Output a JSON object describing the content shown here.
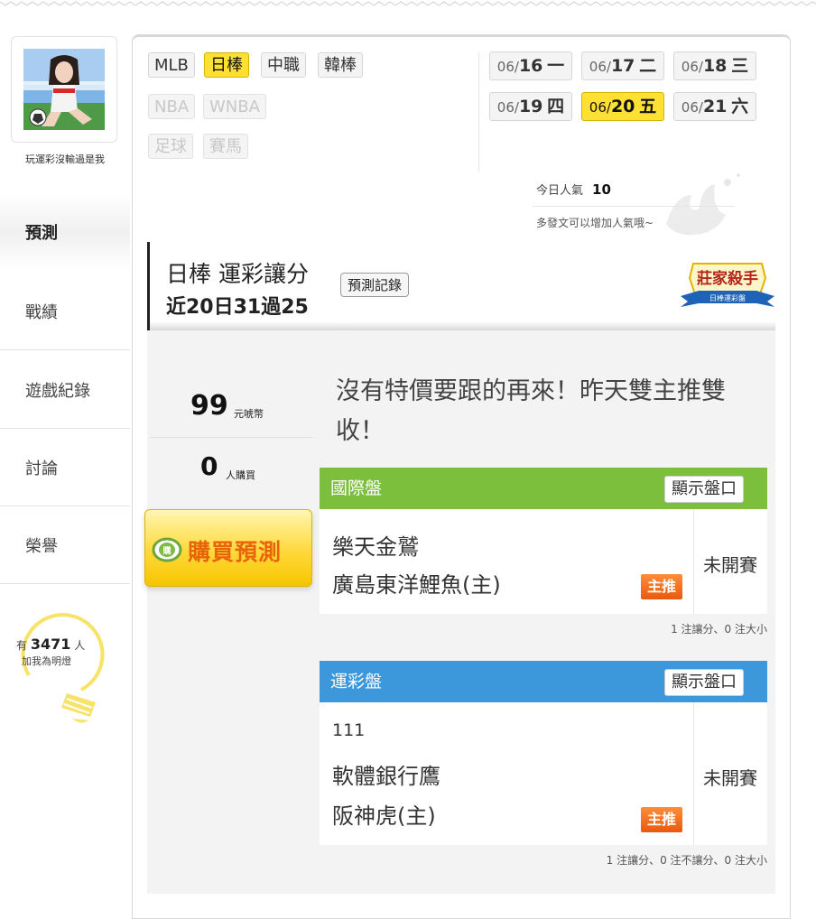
{
  "user": {
    "name": "玩運彩沒輸過是我"
  },
  "sidebar": {
    "items": [
      {
        "label": "預測",
        "active": true
      },
      {
        "label": "戰績"
      },
      {
        "label": "遊戲紀錄"
      },
      {
        "label": "討論"
      },
      {
        "label": "榮譽"
      }
    ],
    "fans": {
      "prefix": "有",
      "count": "3471",
      "suffix": "人",
      "caption": "加我為明燈"
    }
  },
  "leagues": [
    {
      "label": "MLB",
      "state": "normal"
    },
    {
      "label": "日棒",
      "state": "selected"
    },
    {
      "label": "中職",
      "state": "normal"
    },
    {
      "label": "韓棒",
      "state": "normal"
    },
    {
      "label": "NBA",
      "state": "disabled"
    },
    {
      "label": "WNBA",
      "state": "disabled"
    },
    {
      "label": "足球",
      "state": "disabled"
    },
    {
      "label": "賽馬",
      "state": "disabled"
    }
  ],
  "dates": [
    {
      "month": "06/",
      "day": "16",
      "weekday": "一"
    },
    {
      "month": "06/",
      "day": "17",
      "weekday": "二"
    },
    {
      "month": "06/",
      "day": "18",
      "weekday": "三"
    },
    {
      "month": "06/",
      "day": "19",
      "weekday": "四"
    },
    {
      "month": "06/",
      "day": "20",
      "weekday": "五",
      "selected": true
    },
    {
      "month": "06/",
      "day": "21",
      "weekday": "六"
    }
  ],
  "popularity": {
    "label": "今日人氣",
    "value": "10",
    "hint": "多發文可以增加人氣哦~"
  },
  "prediction": {
    "title": "日棒 運彩讓分",
    "record": "近20日31過25",
    "history_button": "預測記錄",
    "badge_title": "莊家殺手",
    "badge_sub": "日棒運彩盤"
  },
  "stats": {
    "price": "99",
    "price_unit": "元唬幣",
    "buyers": "0",
    "buyers_unit": "人購買",
    "buy_button": "購買預測",
    "buy_icon_text": "購"
  },
  "message": "沒有特價要跟的再來！昨天雙主推雙收！",
  "bets": [
    {
      "title": "國際盤",
      "bar_color": "#7bbf3c",
      "show_button": "顯示盤口",
      "game_id": "",
      "away": "樂天金鷲",
      "home": "廣島東洋鯉魚(主)",
      "tag": "主推",
      "status": "未開賽",
      "note": "1 注讓分、0 注大小"
    },
    {
      "title": "運彩盤",
      "bar_color": "#3d97db",
      "show_button": "顯示盤口",
      "game_id": "111",
      "away": "軟體銀行鷹",
      "home": "阪神虎(主)",
      "tag": "主推",
      "status": "未開賽",
      "note": "1 注讓分、0 注不讓分、0 注大小"
    }
  ]
}
